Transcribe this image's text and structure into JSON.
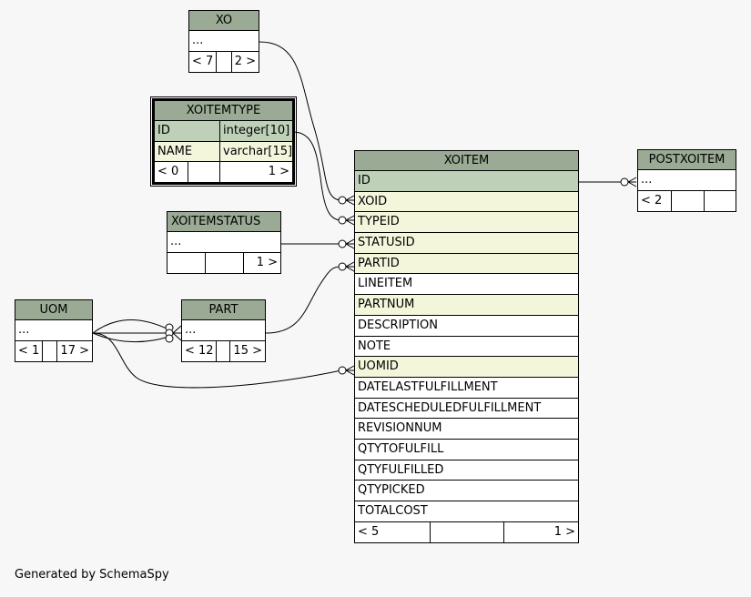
{
  "tables": {
    "xo": {
      "name": "XO",
      "rows": [
        "..."
      ],
      "footer": [
        "< 7",
        "",
        "2 >"
      ]
    },
    "xoitemtype": {
      "name": "XOITEMTYPE",
      "rows": [
        {
          "col": "ID",
          "type": "integer[10]"
        },
        {
          "col": "NAME",
          "type": "varchar[15]"
        }
      ],
      "footer": [
        "< 0",
        "",
        "1 >"
      ]
    },
    "xoitemstatus": {
      "name": "XOITEMSTATUS",
      "rows": [
        "..."
      ],
      "footer": [
        "",
        "",
        "1 >"
      ]
    },
    "uom": {
      "name": "UOM",
      "rows": [
        "..."
      ],
      "footer": [
        "< 1",
        "",
        "17 >"
      ]
    },
    "part": {
      "name": "PART",
      "rows": [
        "..."
      ],
      "footer": [
        "< 12",
        "",
        "15 >"
      ]
    },
    "postxoitem": {
      "name": "POSTXOITEM",
      "rows": [
        "..."
      ],
      "footer": [
        "< 2",
        "",
        ""
      ]
    },
    "xoitem": {
      "name": "XOITEM",
      "columns": [
        "ID",
        "XOID",
        "TYPEID",
        "STATUSID",
        "PARTID",
        "LINEITEM",
        "PARTNUM",
        "DESCRIPTION",
        "NOTE",
        "UOMID",
        "DATELASTFULFILLMENT",
        "DATESCHEDULEDFULFILLMENT",
        "REVISIONNUM",
        "QTYTOFULFILL",
        "QTYFULFILLED",
        "QTYPICKED",
        "TOTALCOST"
      ],
      "column_kinds": [
        "pk",
        "fk",
        "fk",
        "fk",
        "fk",
        "plain",
        "fk",
        "plain",
        "plain",
        "fk",
        "plain",
        "plain",
        "plain",
        "plain",
        "plain",
        "plain",
        "plain"
      ],
      "footer": [
        "< 5",
        "",
        "1 >"
      ]
    }
  },
  "colors": {
    "header": "#9aaa94",
    "primary_key": "#bed1b8",
    "foreign_key": "#f4f6dc",
    "background": "#f7f7f7"
  },
  "footer_note": "Generated by SchemaSpy"
}
